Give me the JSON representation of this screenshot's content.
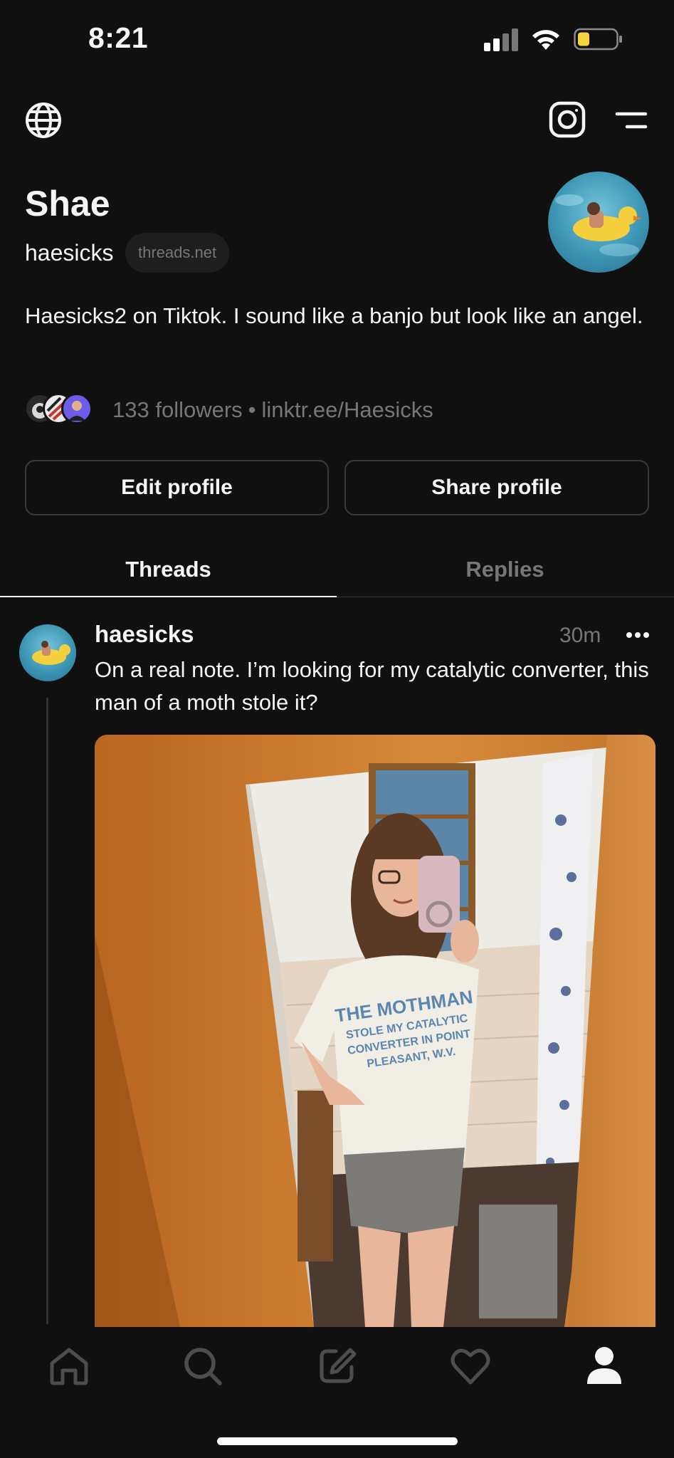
{
  "status_bar": {
    "time": "8:21",
    "battery_color": "#f5d33c"
  },
  "top_nav": {
    "globe_icon": "globe-icon",
    "instagram_icon": "instagram-icon",
    "menu_icon": "menu-icon"
  },
  "profile": {
    "name": "Shae",
    "handle": "haesicks",
    "handle_badge": "threads.net",
    "bio": "Haesicks2 on Tiktok. I sound like a banjo but look like an angel.",
    "followers": "133 followers",
    "separator": "•",
    "link": "linktr.ee/Haesicks"
  },
  "actions": {
    "edit_label": "Edit profile",
    "share_label": "Share profile"
  },
  "tabs": [
    {
      "label": "Threads",
      "active": true
    },
    {
      "label": "Replies",
      "active": false
    }
  ],
  "post": {
    "author": "haesicks",
    "time": "30m",
    "text": "On a real note. I’m looking for my catalytic converter, this man of a moth stole it?",
    "shirt_text": [
      "THE MOTHMAN",
      "STOLE MY CATALYTIC",
      "CONVERTER IN POINT",
      "PLEASANT, W.V."
    ]
  },
  "bottom_nav": {
    "items": [
      "home-icon",
      "search-icon",
      "compose-icon",
      "heart-icon",
      "profile-icon"
    ],
    "active": "profile-icon"
  },
  "colors": {
    "background": "#101010",
    "text_primary": "#f3f5f7",
    "text_secondary": "#777777",
    "border": "#3a3a3a"
  }
}
